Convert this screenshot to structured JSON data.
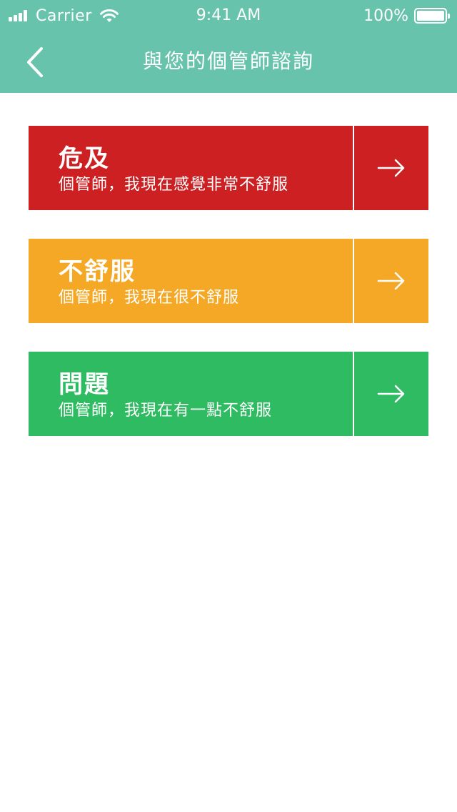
{
  "status_bar": {
    "carrier": "Carrier",
    "time": "9:41 AM",
    "battery": "100%",
    "icons": [
      "signal-icon",
      "wifi-icon",
      "battery-icon"
    ]
  },
  "nav": {
    "title": "與您的個管師諮詢",
    "back_icon": "chevron-left-icon",
    "background": "#67c3ab"
  },
  "options": [
    {
      "title": "危及",
      "subtitle": "個管師，我現在感覺非常不舒服",
      "color": "#cc2023",
      "icon": "arrow-right-icon"
    },
    {
      "title": "不舒服",
      "subtitle": "個管師，我現在很不舒服",
      "color": "#f5a826",
      "icon": "arrow-right-icon"
    },
    {
      "title": "問題",
      "subtitle": "個管師，我現在有一點不舒服",
      "color": "#2ebb62",
      "icon": "arrow-right-icon"
    }
  ]
}
